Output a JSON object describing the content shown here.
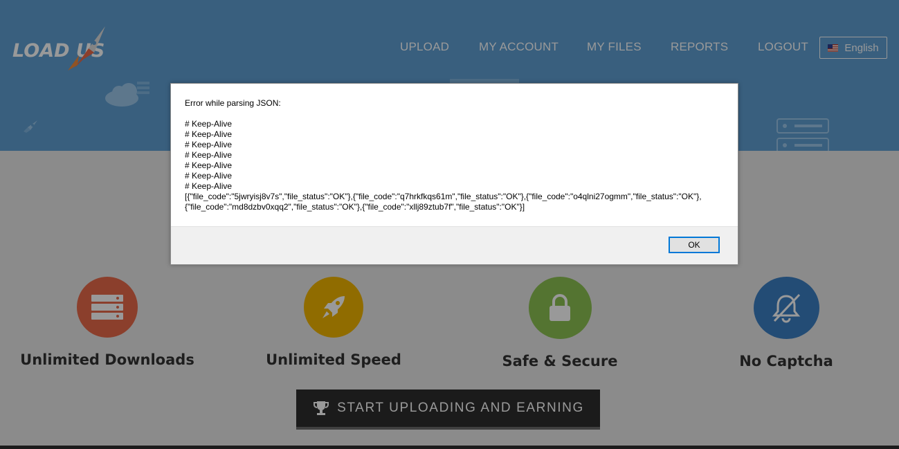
{
  "header": {
    "logo_text": "LOAD  US",
    "nav": [
      {
        "label": "UPLOAD"
      },
      {
        "label": "MY ACCOUNT"
      },
      {
        "label": "MY FILES"
      },
      {
        "label": "REPORTS"
      },
      {
        "label": "LOGOUT"
      }
    ],
    "language": "English"
  },
  "features": [
    {
      "title": "Unlimited Downloads",
      "icon": "server-icon",
      "color": "#e8694a"
    },
    {
      "title": "Unlimited Speed",
      "icon": "rocket-icon",
      "color": "#f0b400"
    },
    {
      "title": "Safe & Secure",
      "icon": "lock-icon",
      "color": "#8cc152"
    },
    {
      "title": "No Captcha",
      "icon": "bell-off-icon",
      "color": "#3b7fc4"
    }
  ],
  "cta": {
    "label": "START UPLOADING AND EARNING",
    "icon": "trophy-icon"
  },
  "dialog": {
    "title": "Error while parsing JSON:",
    "lines": [
      "# Keep-Alive",
      "# Keep-Alive",
      "# Keep-Alive",
      "# Keep-Alive",
      "# Keep-Alive",
      "# Keep-Alive",
      "# Keep-Alive",
      "[{\"file_code\":\"5jwryisj8v7s\",\"file_status\":\"OK\"},{\"file_code\":\"q7hrkfkqs61m\",\"file_status\":\"OK\"},{\"file_code\":\"o4qlni27ogmm\",\"file_status\":\"OK\"},",
      "{\"file_code\":\"md8dzbv0xqq2\",\"file_status\":\"OK\"},{\"file_code\":\"xllj89ztub7f\",\"file_status\":\"OK\"}]"
    ],
    "ok_label": "OK"
  },
  "colors": {
    "header_bg": "#5f9fd3",
    "accent": "#0078d7"
  }
}
